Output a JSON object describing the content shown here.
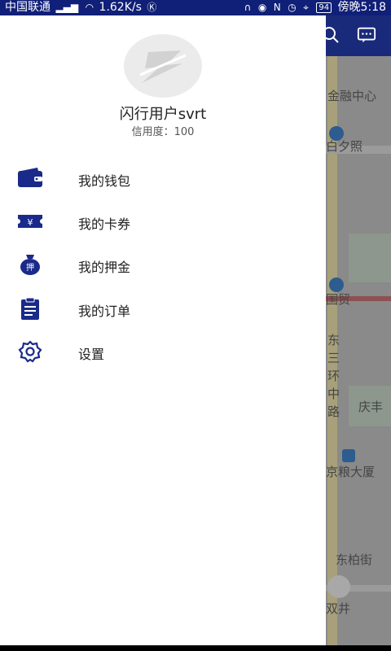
{
  "status_bar": {
    "carrier": "中国联通",
    "speed": "1.62K/s",
    "battery": "94",
    "time": "傍晚5:18"
  },
  "drawer": {
    "username": "闪行用户svrt",
    "credit": "信用度：100",
    "menu": [
      {
        "label": "我的钱包",
        "icon": "wallet-icon"
      },
      {
        "label": "我的卡券",
        "icon": "ticket-icon"
      },
      {
        "label": "我的押金",
        "icon": "deposit-bag-icon"
      },
      {
        "label": "我的订单",
        "icon": "order-clipboard-icon"
      },
      {
        "label": "设置",
        "icon": "gear-icon"
      }
    ]
  },
  "map": {
    "labels": [
      "金融中心",
      "白夕照",
      "国贸",
      "东",
      "三",
      "环",
      "中",
      "路",
      "庆丰",
      "京粮大厦",
      "东柏街",
      "双井"
    ]
  },
  "colors": {
    "status_bar": "#101f77",
    "icon_blue": "#1a2a8a",
    "map_header": "#1a2a7a"
  }
}
